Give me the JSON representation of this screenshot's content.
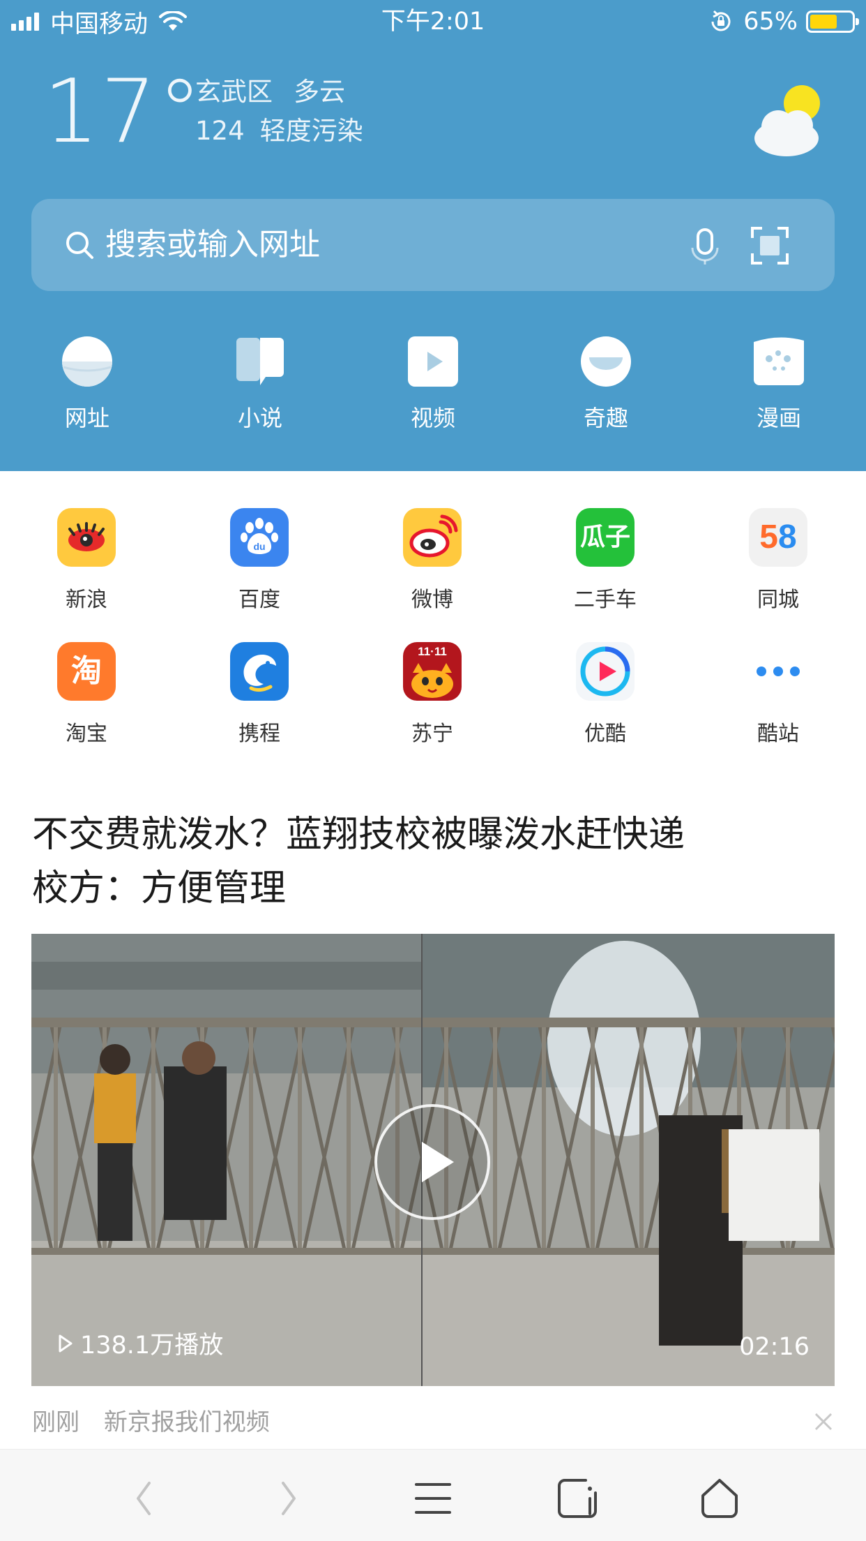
{
  "status": {
    "carrier": "中国移动",
    "time": "下午2:01",
    "battery": "65%",
    "battery_level": 0.65
  },
  "weather": {
    "temperature": "17°",
    "district": "玄武区",
    "condition": "多云",
    "aqi": "124",
    "air_quality": "轻度污染"
  },
  "search": {
    "placeholder": "搜索或输入网址"
  },
  "quicknav": [
    {
      "label": "网址",
      "icon": "globe-icon"
    },
    {
      "label": "小说",
      "icon": "book-icon"
    },
    {
      "label": "视频",
      "icon": "video-play-icon"
    },
    {
      "label": "奇趣",
      "icon": "bowl-icon"
    },
    {
      "label": "漫画",
      "icon": "comic-icon"
    }
  ],
  "apps": [
    {
      "label": "新浪",
      "icon": "sina-icon"
    },
    {
      "label": "百度",
      "icon": "baidu-icon"
    },
    {
      "label": "微博",
      "icon": "weibo-icon"
    },
    {
      "label": "二手车",
      "icon": "guazi-icon",
      "icon_text": "瓜子"
    },
    {
      "label": "同城",
      "icon": "58-icon",
      "icon_text": "58"
    },
    {
      "label": "淘宝",
      "icon": "taobao-icon",
      "icon_text": "淘"
    },
    {
      "label": "携程",
      "icon": "ctrip-icon"
    },
    {
      "label": "苏宁",
      "icon": "suning-icon",
      "icon_text": "11·11"
    },
    {
      "label": "优酷",
      "icon": "youku-icon"
    },
    {
      "label": "酷站",
      "icon": "more-dots-icon"
    }
  ],
  "news": {
    "title_line1": "不交费就泼水？蓝翔技校被曝泼水赶快递",
    "title_line2": "校方：方便管理",
    "views": "138.1万播放",
    "duration": "02:16",
    "time": "刚刚",
    "source": "新京报我们视频"
  },
  "colors": {
    "header_bg": "#4b9ccb",
    "toolbar_bg": "#f7f7f7"
  }
}
